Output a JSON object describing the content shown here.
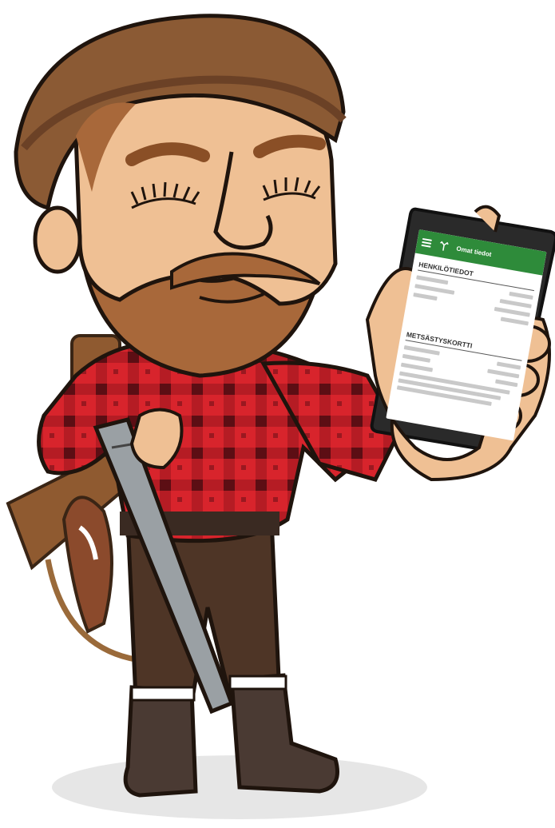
{
  "phone": {
    "app_title": "Omat tiedot",
    "sections": [
      {
        "title": "HENKILÖTIEDOT"
      },
      {
        "title": "METSÄSTYSKORTTI"
      }
    ],
    "icons": [
      "menu-icon",
      "antler-logo-icon"
    ]
  },
  "colors": {
    "app_green": "#2e8b3a",
    "shirt_red": "#d8242c",
    "shirt_dark": "#7a1218",
    "beard": "#a8683a",
    "skin": "#efc094",
    "hat": "#8b5a34",
    "pants": "#4e3526",
    "boots": "#4a3a33"
  }
}
